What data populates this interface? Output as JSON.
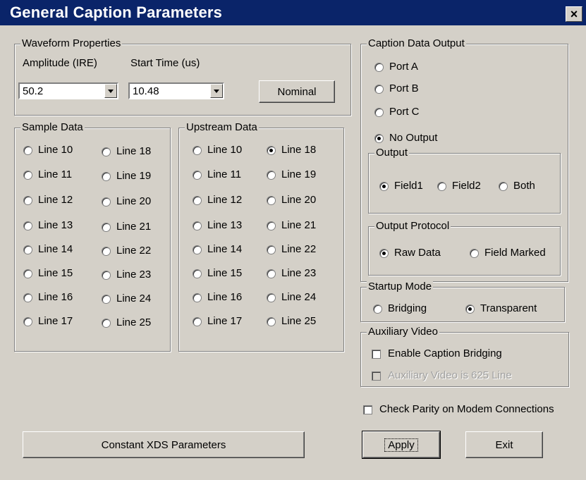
{
  "window": {
    "title": "General Caption Parameters",
    "close_glyph": "×"
  },
  "waveform": {
    "legend": "Waveform Properties",
    "amplitude_label": "Amplitude (IRE)",
    "start_time_label": "Start Time (us)",
    "amplitude_value": "50.2",
    "start_time_value": "10.48",
    "nominal_label": "Nominal"
  },
  "sample_data": {
    "legend": "Sample Data",
    "col1": [
      "Line 10",
      "Line 11",
      "Line 12",
      "Line 13",
      "Line 14",
      "Line 15",
      "Line 16",
      "Line 17"
    ],
    "col2": [
      "Line 18",
      "Line 19",
      "Line 20",
      "Line 21",
      "Line 22",
      "Line 23",
      "Line 24",
      "Line 25"
    ]
  },
  "upstream_data": {
    "legend": "Upstream Data",
    "col1": [
      "Line 10",
      "Line 11",
      "Line 12",
      "Line 13",
      "Line 14",
      "Line 15",
      "Line 16",
      "Line 17"
    ],
    "col2": [
      "Line 18",
      "Line 19",
      "Line 20",
      "Line 21",
      "Line 22",
      "Line 23",
      "Line 24",
      "Line 25"
    ],
    "selected": "Line 18"
  },
  "caption_output": {
    "legend": "Caption Data Output",
    "ports": [
      "Port A",
      "Port B",
      "Port C",
      "No Output"
    ],
    "selected_port": "No Output",
    "output": {
      "legend": "Output",
      "options": [
        "Field1",
        "Field2",
        "Both"
      ],
      "selected": "Field1"
    },
    "protocol": {
      "legend": "Output Protocol",
      "options": [
        "Raw Data",
        "Field Marked"
      ],
      "selected": "Raw Data"
    }
  },
  "startup_mode": {
    "legend": "Startup Mode",
    "options": [
      "Bridging",
      "Transparent"
    ],
    "selected": "Transparent"
  },
  "auxiliary_video": {
    "legend": "Auxiliary Video",
    "enable_bridging": "Enable Caption Bridging",
    "is_625_line": "Auxiliary Video is 625 Line"
  },
  "check_parity": "Check Parity on Modem Connections",
  "buttons": {
    "constant_xds": "Constant XDS Parameters",
    "apply": "Apply",
    "exit": "Exit"
  }
}
